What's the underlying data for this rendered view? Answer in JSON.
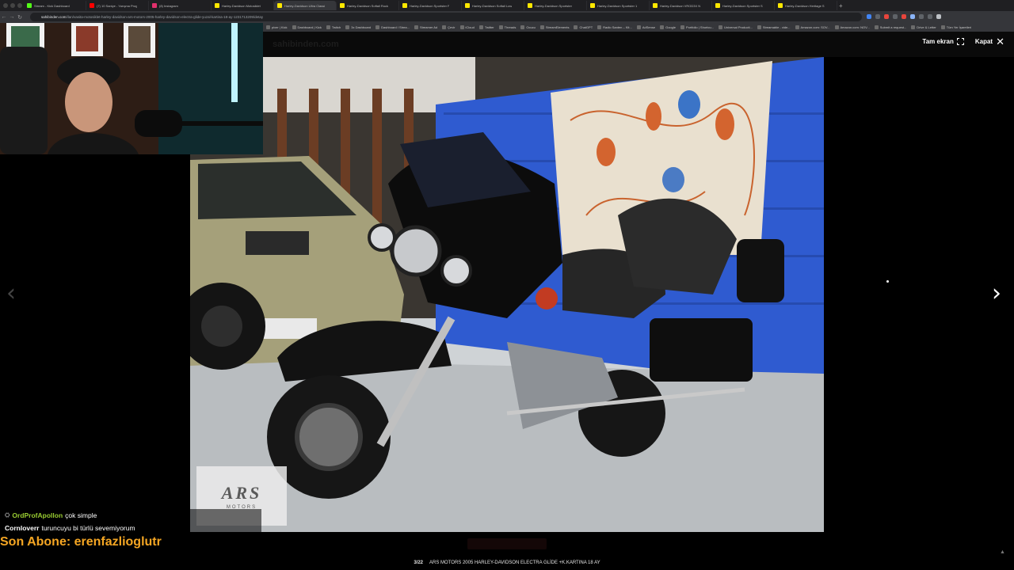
{
  "browser": {
    "tabs": [
      {
        "title": "Stream - Kick Dashboard",
        "fav": "#53fc18",
        "active": false
      },
      {
        "title": "(7) 10 Saniye - Yarışma Prog",
        "fav": "#ff0000",
        "active": false
      },
      {
        "title": "(8) Instagram",
        "fav": "#e1306c",
        "active": false
      },
      {
        "title": "Harley-Davidson Motosiklet",
        "fav": "#ffe800",
        "active": false
      },
      {
        "title": "Harley-Davidson Ultra Classi",
        "fav": "#ffe800",
        "active": true
      },
      {
        "title": "Harley-Davidson Softail Rock",
        "fav": "#ffe800",
        "active": false
      },
      {
        "title": "Harley-Davidson Sportster F",
        "fav": "#ffe800",
        "active": false
      },
      {
        "title": "Harley-Davidson Softail Low",
        "fav": "#ffe800",
        "active": false
      },
      {
        "title": "Harley-Davidson Sportster",
        "fav": "#ffe800",
        "active": false
      },
      {
        "title": "Harley-Davidson Sportster 1",
        "fav": "#ffe800",
        "active": false
      },
      {
        "title": "Harley-Davidson VROD3X N",
        "fav": "#ffe800",
        "active": false
      },
      {
        "title": "Harley-Davidson Sportster S",
        "fav": "#ffe800",
        "active": false
      },
      {
        "title": "Harley-Davidson Heritage S",
        "fav": "#ffe800",
        "active": false
      }
    ],
    "new_tab": "+",
    "url_host": "sahibinden.com",
    "url_path": "/ilan/vasita-motosiklet-harley-davidson-ars-motors-2005-harley-davidson-electra-glide-yuzal-kartina-18-ay-1231713209/detay",
    "bookmarks": [
      "pixer | Kick",
      "Dashboard | Kick",
      "Twitch",
      "3x Dashboard",
      "Dashboard / Strea...",
      "Streamer Ad",
      "Çevir",
      "iCloud",
      "Twitter",
      "Threads",
      "Ocucu",
      "StreamElements",
      "ChatGPT",
      "Radio Santen – Kit...",
      "AdSense",
      "Google",
      "Portfolio | Shortcu...",
      "Universal Producti...",
      "Streamable - vide...",
      "Amazon.com: SOV...",
      "Amazon.com: NOV...",
      "Submit a request...",
      "Drive & Letter",
      "Tüm Yer İşaretleri"
    ]
  },
  "site": {
    "logo": "sahibinden.com"
  },
  "viewer": {
    "fullscreen_label": "Tam ekran",
    "close_label": "Kapat",
    "counter": "3/22",
    "title": "ARS MOTORS 2005 HARLEY-DAVIDSON ELECTRA GLİDE +K.KARTINA 18 AY",
    "prev_arrow": "‹",
    "next_arrow": "›",
    "dealer_logo": {
      "name": "ARS",
      "sub": "MOTORS"
    }
  },
  "chat": {
    "messages": [
      {
        "user": "OrdProfApollon",
        "text": "çok simple",
        "color": "green"
      },
      {
        "user": "Cornloverr",
        "text": "turuncuyu bi türlü sevemiyorum",
        "color": "white"
      }
    ],
    "last_sub": "Son Abone: erenfazlioglutr"
  }
}
